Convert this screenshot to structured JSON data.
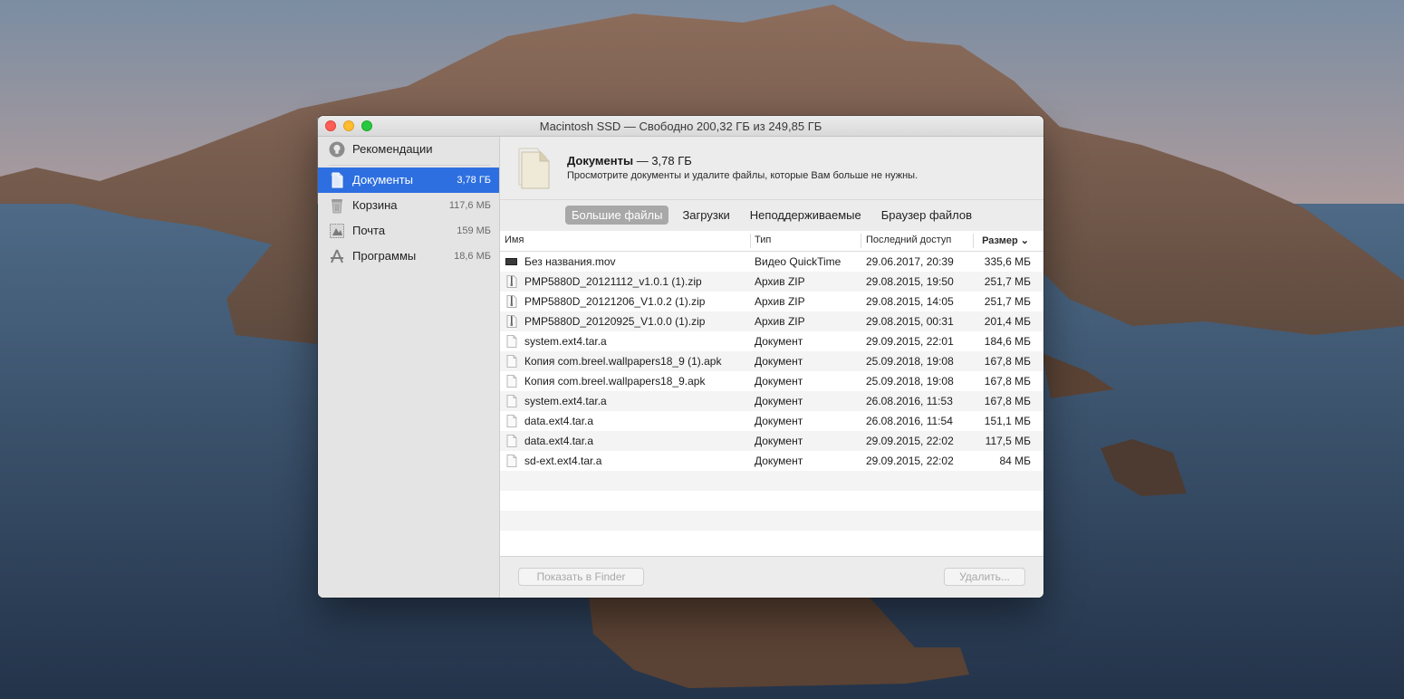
{
  "window": {
    "title": "Macintosh SSD — Свободно 200,32 ГБ из 249,85 ГБ"
  },
  "sidebar": {
    "items": [
      {
        "label": "Рекомендации",
        "size": "",
        "icon": "lightbulb-icon"
      },
      {
        "label": "Документы",
        "size": "3,78 ГБ",
        "icon": "document-icon",
        "selected": true
      },
      {
        "label": "Корзина",
        "size": "117,6 МБ",
        "icon": "trash-icon"
      },
      {
        "label": "Почта",
        "size": "159 МБ",
        "icon": "mail-stamp-icon"
      },
      {
        "label": "Программы",
        "size": "18,6 МБ",
        "icon": "applications-icon"
      }
    ]
  },
  "header": {
    "category_name": "Документы",
    "category_size": " — 3,78 ГБ",
    "description": "Просмотрите документы и удалите файлы, которые Вам больше не нужны."
  },
  "tabs": [
    {
      "label": "Большие файлы",
      "active": true
    },
    {
      "label": "Загрузки",
      "active": false
    },
    {
      "label": "Неподдерживаемые",
      "active": false
    },
    {
      "label": "Браузер файлов",
      "active": false
    }
  ],
  "table": {
    "columns": {
      "name": "Имя",
      "type": "Тип",
      "last_access": "Последний доступ",
      "size": "Размер",
      "sort_indicator": "⌄"
    },
    "rows": [
      {
        "icon": "movie-file-icon",
        "name": "Без названия.mov",
        "type": "Видео QuickTime",
        "date": "29.06.2017, 20:39",
        "size": "335,6 МБ"
      },
      {
        "icon": "zip-file-icon",
        "name": "PMP5880D_20121112_v1.0.1 (1).zip",
        "type": "Архив ZIP",
        "date": "29.08.2015, 19:50",
        "size": "251,7 МБ"
      },
      {
        "icon": "zip-file-icon",
        "name": "PMP5880D_20121206_V1.0.2 (1).zip",
        "type": "Архив ZIP",
        "date": "29.08.2015, 14:05",
        "size": "251,7 МБ"
      },
      {
        "icon": "zip-file-icon",
        "name": "PMP5880D_20120925_V1.0.0 (1).zip",
        "type": "Архив ZIP",
        "date": "29.08.2015, 00:31",
        "size": "201,4 МБ"
      },
      {
        "icon": "document-file-icon",
        "name": "system.ext4.tar.a",
        "type": "Документ",
        "date": "29.09.2015, 22:01",
        "size": "184,6 МБ"
      },
      {
        "icon": "document-file-icon",
        "name": "Копия com.breel.wallpapers18_9 (1).apk",
        "type": "Документ",
        "date": "25.09.2018, 19:08",
        "size": "167,8 МБ"
      },
      {
        "icon": "document-file-icon",
        "name": "Копия com.breel.wallpapers18_9.apk",
        "type": "Документ",
        "date": "25.09.2018, 19:08",
        "size": "167,8 МБ"
      },
      {
        "icon": "document-file-icon",
        "name": "system.ext4.tar.a",
        "type": "Документ",
        "date": "26.08.2016, 11:53",
        "size": "167,8 МБ"
      },
      {
        "icon": "document-file-icon",
        "name": "data.ext4.tar.a",
        "type": "Документ",
        "date": "26.08.2016, 11:54",
        "size": "151,1 МБ"
      },
      {
        "icon": "document-file-icon",
        "name": "data.ext4.tar.a",
        "type": "Документ",
        "date": "29.09.2015, 22:02",
        "size": "117,5 МБ"
      },
      {
        "icon": "document-file-icon",
        "name": "sd-ext.ext4.tar.a",
        "type": "Документ",
        "date": "29.09.2015, 22:02",
        "size": "84 МБ"
      }
    ]
  },
  "footer": {
    "show_in_finder": "Показать в Finder",
    "delete": "Удалить..."
  },
  "colors": {
    "selection": "#2d6fe0",
    "tab_active": "#a8a8a8"
  }
}
